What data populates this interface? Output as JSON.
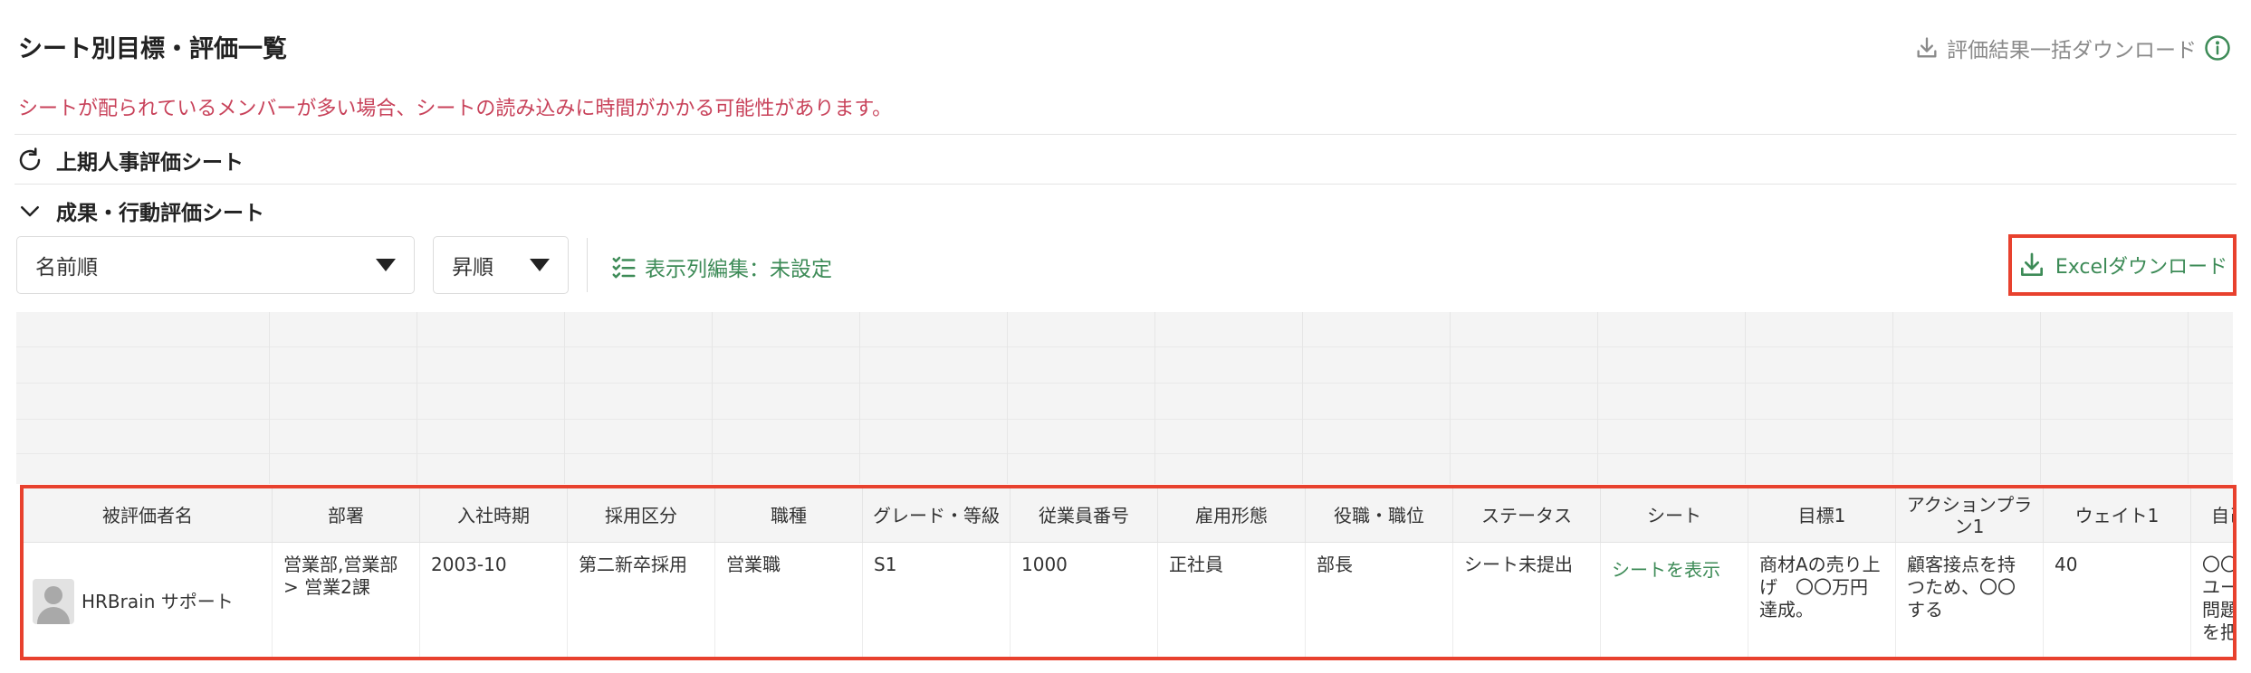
{
  "page": {
    "title": "シート別目標・評価一覧",
    "bulk_download_label": "評価結果一括ダウンロード",
    "warning": "シートが配られているメンバーが多い場合、シートの読み込みに時間がかかる可能性があります。"
  },
  "sections": [
    {
      "label": "上期人事評価シート",
      "state": "loading"
    },
    {
      "label": "成果・行動評価シート",
      "state": "expanded"
    }
  ],
  "toolbar": {
    "sort_select": {
      "value": "名前順"
    },
    "order_select": {
      "value": "昇順"
    },
    "column_edit_label": "表示列編集：未設定",
    "excel_download_label": "Excelダウンロード"
  },
  "table": {
    "headers": [
      "被評価者名",
      "部署",
      "入社時期",
      "採用区分",
      "職種",
      "グレード・等級",
      "従業員番号",
      "雇用形態",
      "役職・職位",
      "ステータス",
      "シート",
      "目標1",
      "アクションプラン1",
      "ウェイト1",
      "自己"
    ],
    "row": {
      "name": "HRBrain サポート",
      "department": "営業部,営業部 > 営業2課",
      "join_date": "2003-10",
      "hire_type": "第二新卒採用",
      "job_type": "営業職",
      "grade": "S1",
      "employee_no": "1000",
      "employment_type": "正社員",
      "position": "部長",
      "status": "シート未提出",
      "sheet_link": "シートを表示",
      "goal1": "商材Aの売り上げ　〇〇万円達成。",
      "action_plan1": "顧客接点を持つため、〇〇する",
      "weight1": "40",
      "self_eval": "〇〇ユー問題を把"
    }
  },
  "colors": {
    "accent_green": "#3d8b57",
    "warning_red": "#c8425a",
    "highlight_red": "#e8412e"
  }
}
